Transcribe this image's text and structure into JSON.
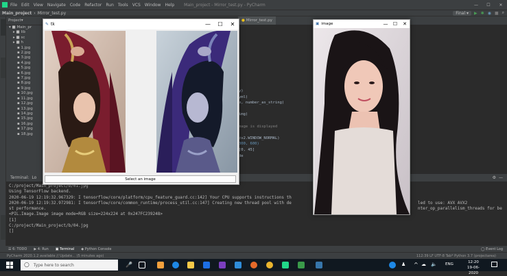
{
  "ide": {
    "menu": [
      "File",
      "Edit",
      "View",
      "Navigate",
      "Code",
      "Refactor",
      "Run",
      "Tools",
      "VCS",
      "Window",
      "Help"
    ],
    "title": "Main_project - Mirror_test.py - PyCharm",
    "breadcrumb": [
      "Main_project",
      "Mirror_test.py"
    ],
    "run_config": "Final",
    "project_tab": "Project",
    "project_items": [
      "Main_pr",
      "lib",
      "sc",
      "h",
      "1.jpg",
      "2.jpg",
      "3.jpg",
      "4.jpg",
      "5.jpg",
      "6.jpg",
      "7.jpg",
      "8.jpg",
      "9.jpg",
      "10.jpg",
      "11.jpg",
      "12.jpg",
      "13.jpg",
      "14.jpg",
      "15.jpg",
      "16.jpg",
      "17.jpg",
      "18.jpg"
    ],
    "editor_tab": "Mirror_test.py",
    "code_lines": [
      {
        "t": "y)"
      },
      {
        "t": "yml)"
      },
      {
        "t": "e, number_as_string)"
      },
      {
        "t": ""
      },
      {
        "t": "img)"
      },
      {
        "t": ""
      },
      {
        "t": "mage is displayed"
      },
      {
        "t": ""
      },
      {
        "t": "cv2.WINDOW_NORMAL)"
      },
      {
        "t": "  300, 600)"
      },
      {
        "t": "[0, 45]"
      },
      {
        "t": "de"
      }
    ]
  },
  "terminal": {
    "header_label": "Terminal:",
    "header_tab": "Lo",
    "lines": [
      "C:/project/Main_project/b/01.jpg",
      "Using TensorFlow backend.",
      "2020-06-19 12:19:32.967329: I tensorflow/core/platform/cpu_feature_guard.cc:142] Your CPU supports instructions th",
      "2020-06-19 12:19:32.972981: I tensorflow/core/common_runtime/process_util.cc:147] Creating new thread pool with de",
      "st performance.",
      "<PIL.Image.Image image mode=RGB size=224x224 at 0x247FC239248>",
      "[1]",
      "C:/project/Main_project/b/04.jpg",
      "[]"
    ],
    "right_line_1": "led to use: AVX AVX2",
    "right_line_2": "nter_op_parallelism_threads for be"
  },
  "bottom_tools": [
    "6: TODO",
    "4: Run",
    "Terminal",
    "Python Console"
  ],
  "event_log": "Event Log",
  "status": {
    "left": "PyCharm 2020.1.2 available // Update... (5 minutes ago)",
    "right": "112:39  LF  UTF-8  Tab*  Python 3.7 (projectarea)"
  },
  "tk_window": {
    "title": "tk",
    "button": "Select an image",
    "controls": [
      "—",
      "☐",
      "✕"
    ]
  },
  "cv_window": {
    "title": "image",
    "controls": [
      "—",
      "☐",
      "✕"
    ]
  },
  "taskbar": {
    "search_placeholder": "Type here to search",
    "lang": "ENG",
    "time": "12:20",
    "date": "19-06-2020"
  },
  "colors": {
    "ide_dark": "#2b2b2b",
    "ide_panel": "#3c3f41",
    "taskbar": "#101820",
    "accent_green": "#499c54"
  }
}
